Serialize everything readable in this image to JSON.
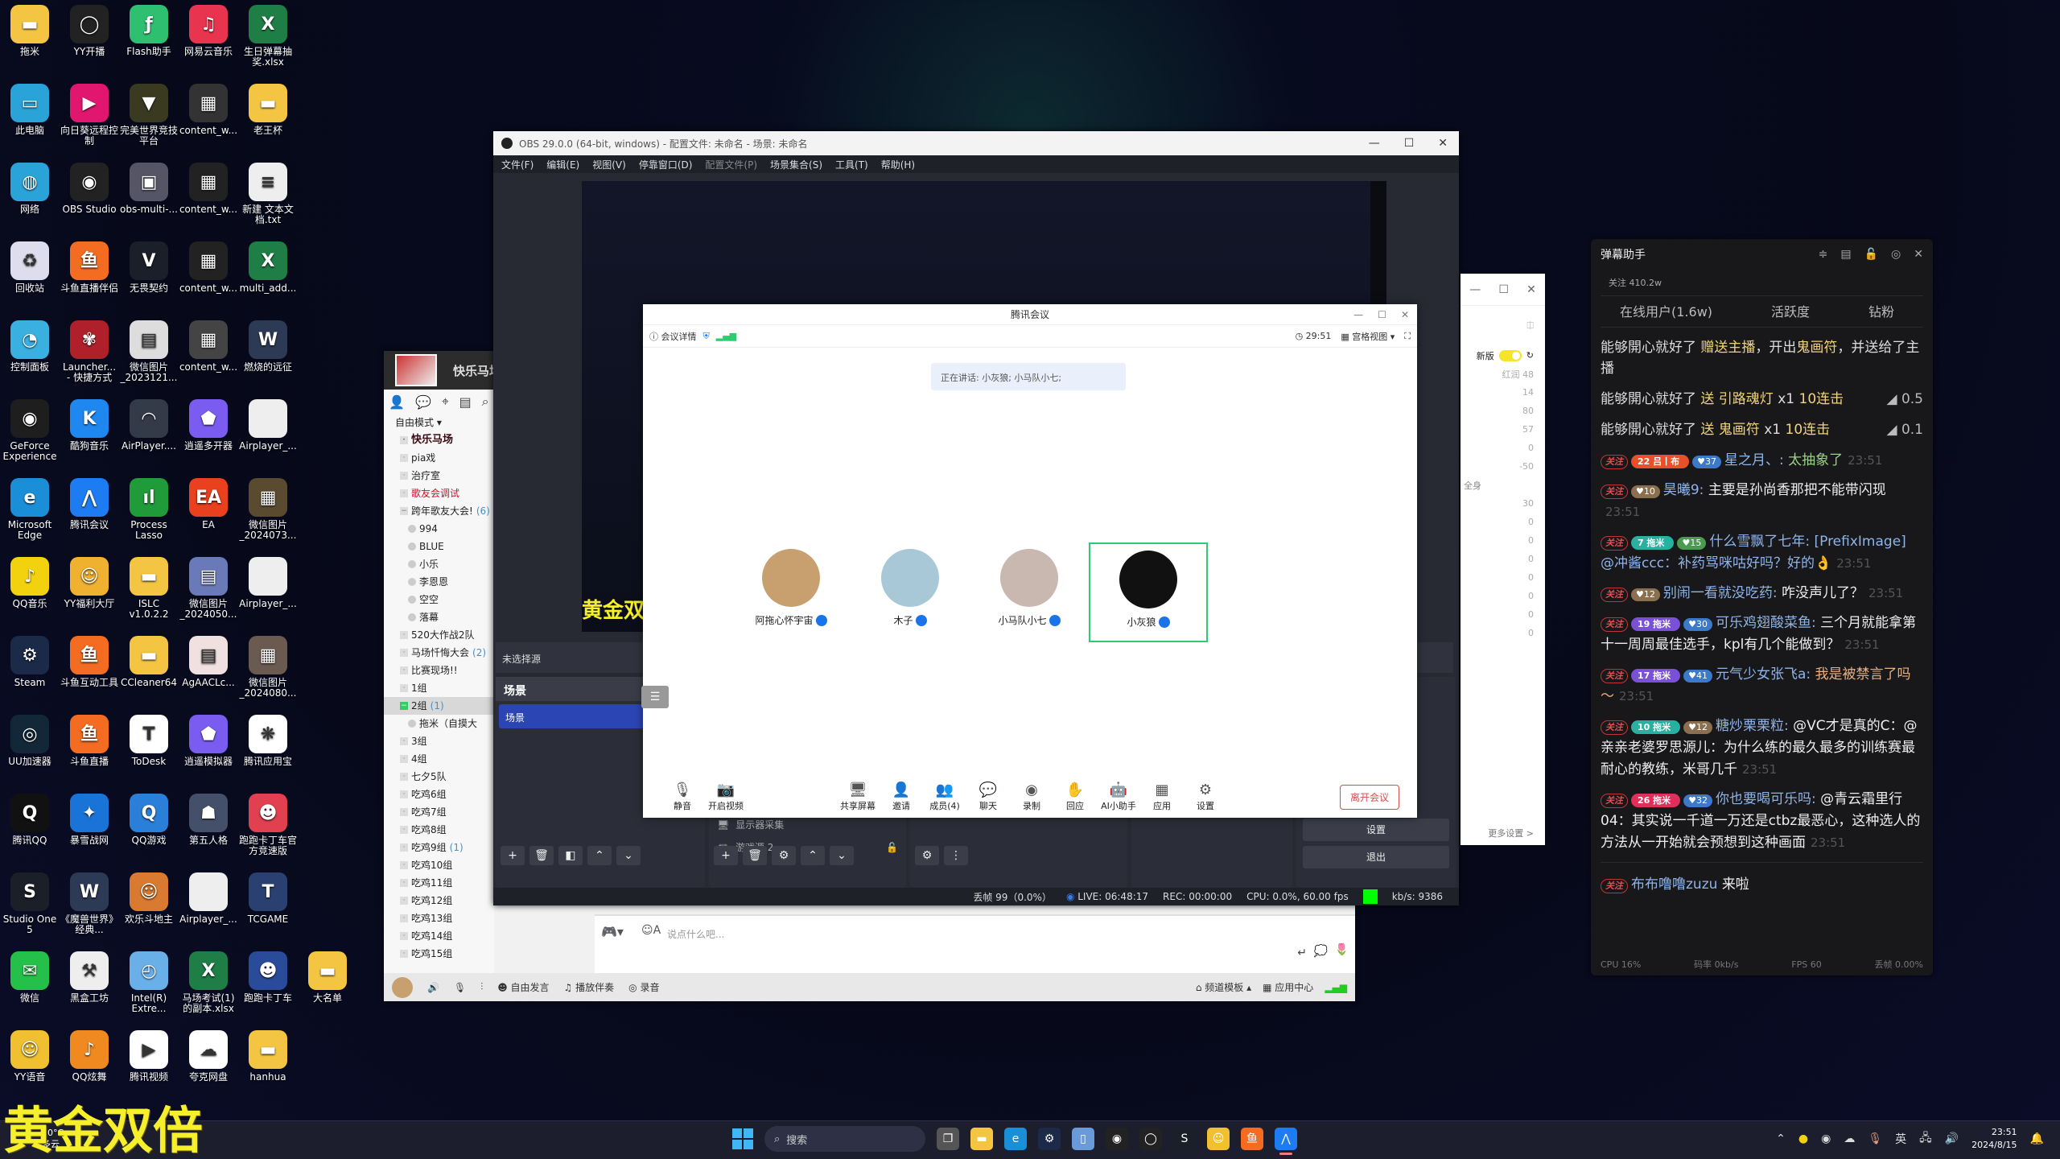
{
  "desktop": {
    "icons": [
      {
        "label": "拖米",
        "icon": "folder-icon",
        "color": "#f4c542",
        "glyph": "▬"
      },
      {
        "label": "YY开播",
        "icon": "yy-live-icon",
        "color": "#222",
        "glyph": "◯"
      },
      {
        "label": "Flash助手",
        "icon": "flash-helper-icon",
        "color": "#2fbf71",
        "glyph": "ƒ"
      },
      {
        "label": "网易云音乐",
        "icon": "netease-music-icon",
        "color": "#e8344e",
        "glyph": "♫"
      },
      {
        "label": "生日弹幕抽奖.xlsx",
        "icon": "excel-icon",
        "color": "#1e7e45",
        "glyph": "X"
      },
      {
        "label": "此电脑",
        "icon": "this-pc-icon",
        "color": "#2aa3d8",
        "glyph": "▭"
      },
      {
        "label": "向日葵远程控制",
        "icon": "sunlogin-icon",
        "color": "#e0166f",
        "glyph": "▶"
      },
      {
        "label": "完美世界竞技平台",
        "icon": "perfect-world-icon",
        "color": "#3a3a20",
        "glyph": "▼"
      },
      {
        "label": "content_w...",
        "icon": "image-file-icon",
        "color": "#333",
        "glyph": "▦"
      },
      {
        "label": "老王杯",
        "icon": "folder-icon",
        "color": "#f4c542",
        "glyph": "▬"
      },
      {
        "label": "网络",
        "icon": "network-icon",
        "color": "#2aa3d8",
        "glyph": "◍"
      },
      {
        "label": "OBS Studio",
        "icon": "obs-icon",
        "color": "#222",
        "glyph": "◉"
      },
      {
        "label": "obs-multi-...",
        "icon": "installer-icon",
        "color": "#556",
        "glyph": "▣"
      },
      {
        "label": "content_w...",
        "icon": "image-file-icon",
        "color": "#222",
        "glyph": "▦"
      },
      {
        "label": "新建 文本文档.txt",
        "icon": "text-file-icon",
        "color": "#eee",
        "glyph": "≡"
      },
      {
        "label": "回收站",
        "icon": "recycle-bin-icon",
        "color": "#dde",
        "glyph": "♻"
      },
      {
        "label": "斗鱼直播伴侣",
        "icon": "douyu-icon",
        "color": "#f36c21",
        "glyph": "鱼"
      },
      {
        "label": "无畏契约",
        "icon": "valorant-icon",
        "color": "#1b1f2a",
        "glyph": "V"
      },
      {
        "label": "content_w...",
        "icon": "image-file-icon",
        "color": "#222",
        "glyph": "▦"
      },
      {
        "label": "multi_add...",
        "icon": "excel-icon",
        "color": "#1e7e45",
        "glyph": "X"
      },
      {
        "label": "控制面板",
        "icon": "control-panel-icon",
        "color": "#3ab0e0",
        "glyph": "◔"
      },
      {
        "label": "Launcher... - 快捷方式",
        "icon": "naraka-icon",
        "color": "#b0202a",
        "glyph": "✾"
      },
      {
        "label": "微信图片_2023121...",
        "icon": "image-file-icon",
        "color": "#ddd",
        "glyph": "▤"
      },
      {
        "label": "content_w...",
        "icon": "image-file-icon",
        "color": "#444",
        "glyph": "▦"
      },
      {
        "label": "燃烧的远征",
        "icon": "wow-icon",
        "color": "#2d3a55",
        "glyph": "W"
      },
      {
        "label": "GeForce Experience",
        "icon": "nvidia-icon",
        "color": "#1e1e1e",
        "glyph": "◉"
      },
      {
        "label": "酷狗音乐",
        "icon": "kugou-icon",
        "color": "#1e88f0",
        "glyph": "K"
      },
      {
        "label": "AirPlayer....",
        "icon": "airplayer-icon",
        "color": "#333a48",
        "glyph": "◠"
      },
      {
        "label": "逍遥多开器",
        "icon": "xiaoyao-multi-icon",
        "color": "#7a5cf0",
        "glyph": "⬟"
      },
      {
        "label": "Airplayer_...",
        "icon": "blank-file-icon",
        "color": "#eee",
        "glyph": " "
      },
      {
        "label": "Microsoft Edge",
        "icon": "edge-icon",
        "color": "#1a8fd8",
        "glyph": "e"
      },
      {
        "label": "腾讯会议",
        "icon": "tencent-meeting-icon",
        "color": "#1d7cf2",
        "glyph": "⋀"
      },
      {
        "label": "Process Lasso",
        "icon": "process-lasso-icon",
        "color": "#1f9b3a",
        "glyph": "ıl"
      },
      {
        "label": "EA",
        "icon": "ea-icon",
        "color": "#e9401d",
        "glyph": "EA"
      },
      {
        "label": "微信图片_2024073...",
        "icon": "image-file-icon",
        "color": "#5a4a30",
        "glyph": "▦"
      },
      {
        "label": "QQ音乐",
        "icon": "qq-music-icon",
        "color": "#f2d20f",
        "glyph": "♪"
      },
      {
        "label": "YY福利大厅",
        "icon": "yy-welfare-icon",
        "color": "#f0b030",
        "glyph": "☺"
      },
      {
        "label": "ISLC v1.0.2.2",
        "icon": "folder-icon",
        "color": "#f4c542",
        "glyph": "▬"
      },
      {
        "label": "微信图片_2024050...",
        "icon": "image-file-icon",
        "color": "#6a7ab8",
        "glyph": "▤"
      },
      {
        "label": "Airplayer_...",
        "icon": "blank-file-icon",
        "color": "#eee",
        "glyph": " "
      },
      {
        "label": "Steam",
        "icon": "steam-icon",
        "color": "#1b2a48",
        "glyph": "⚙"
      },
      {
        "label": "斗鱼互动工具",
        "icon": "douyu-tool-icon",
        "color": "#f36c21",
        "glyph": "鱼"
      },
      {
        "label": "CCleaner64",
        "icon": "folder-icon",
        "color": "#f4c542",
        "glyph": "▬"
      },
      {
        "label": "AgAACLc...",
        "icon": "image-file-icon",
        "color": "#f0e0e0",
        "glyph": "▤"
      },
      {
        "label": "微信图片_2024080...",
        "icon": "image-file-icon",
        "color": "#6a5a50",
        "glyph": "▦"
      },
      {
        "label": "UU加速器",
        "icon": "uu-booster-icon",
        "color": "#122838",
        "glyph": "◎"
      },
      {
        "label": "斗鱼直播",
        "icon": "douyu-live-icon",
        "color": "#f36c21",
        "glyph": "鱼"
      },
      {
        "label": "ToDesk",
        "icon": "todesk-icon",
        "color": "#fff",
        "glyph": "T"
      },
      {
        "label": "逍遥模拟器",
        "icon": "xiaoyao-emulator-icon",
        "color": "#7a5cf0",
        "glyph": "⬟"
      },
      {
        "label": "腾讯应用宝",
        "icon": "tencent-appstore-icon",
        "color": "#fff",
        "glyph": "❋"
      },
      {
        "label": "腾讯QQ",
        "icon": "qq-icon",
        "color": "#111",
        "glyph": "Q"
      },
      {
        "label": "暴雪战网",
        "icon": "battlenet-icon",
        "color": "#1a74d8",
        "glyph": "✦"
      },
      {
        "label": "QQ游戏",
        "icon": "qq-game-icon",
        "color": "#2a80d8",
        "glyph": "Q"
      },
      {
        "label": "第五人格",
        "icon": "identity-v-icon",
        "color": "#44506a",
        "glyph": "☗"
      },
      {
        "label": "跑跑卡丁车官方竞速版",
        "icon": "kartrider-rush-icon",
        "color": "#e04050",
        "glyph": "☻"
      },
      {
        "label": "Studio One 5",
        "icon": "studio-one-icon",
        "color": "#1b1f28",
        "glyph": "S"
      },
      {
        "label": "《魔兽世界》经典...",
        "icon": "wow-classic-icon",
        "color": "#2d3a55",
        "glyph": "W"
      },
      {
        "label": "欢乐斗地主",
        "icon": "doudizhu-icon",
        "color": "#d97a30",
        "glyph": "☺"
      },
      {
        "label": "Airplayer_...",
        "icon": "blank-file-icon",
        "color": "#eee",
        "glyph": " "
      },
      {
        "label": "TCGAME",
        "icon": "tcgame-icon",
        "color": "#2a4070",
        "glyph": "T"
      },
      {
        "label": "微信",
        "icon": "wechat-icon",
        "color": "#25c04a",
        "glyph": "✉"
      },
      {
        "label": "黑盒工坊",
        "icon": "heihe-icon",
        "color": "#eee",
        "glyph": "⚒"
      },
      {
        "label": "Intel(R) Extre...",
        "icon": "intel-xtu-icon",
        "color": "#6ab0e8",
        "glyph": "◴"
      },
      {
        "label": "马场考试(1)的副本.xlsx",
        "icon": "excel-icon",
        "color": "#1e7e45",
        "glyph": "X"
      },
      {
        "label": "跑跑卡丁车",
        "icon": "kartrider-icon",
        "color": "#2a4a9a",
        "glyph": "☻"
      },
      {
        "label": "大名单",
        "icon": "folder-icon",
        "color": "#f4c542",
        "glyph": "▬"
      },
      {
        "label": "YY语音",
        "icon": "yy-voice-icon",
        "color": "#f0c030",
        "glyph": "☺"
      },
      {
        "label": "QQ炫舞",
        "icon": "qq-dance-icon",
        "color": "#f08a20",
        "glyph": "♪"
      },
      {
        "label": "腾讯视频",
        "icon": "tencent-video-icon",
        "color": "#fff",
        "glyph": "▶"
      },
      {
        "label": "夸克网盘",
        "icon": "quark-drive-icon",
        "color": "#fff",
        "glyph": "☁"
      },
      {
        "label": "hanhua",
        "icon": "folder-icon",
        "color": "#f4c542",
        "glyph": "▬"
      }
    ],
    "overlay_text": "黄金双倍"
  },
  "yy": {
    "channel_name": "快乐马场",
    "mode": "自由模式",
    "tree": [
      {
        "label": "快乐马场",
        "type": "root"
      },
      {
        "label": "pia戏",
        "type": "item"
      },
      {
        "label": "治疗室",
        "type": "item"
      },
      {
        "label": "歌友会调试",
        "type": "red"
      },
      {
        "label": "跨年歌友大会!",
        "count": "(6)",
        "type": "expanded"
      },
      {
        "label": "994",
        "type": "member"
      },
      {
        "label": "BLUE",
        "type": "member"
      },
      {
        "label": "小乐",
        "type": "member"
      },
      {
        "label": "李恩恩",
        "type": "member"
      },
      {
        "label": "空空",
        "type": "member"
      },
      {
        "label": "落幕",
        "type": "member"
      },
      {
        "label": "520大作战2队",
        "type": "item"
      },
      {
        "label": "马场忏悔大会",
        "count": "(2)",
        "type": "item"
      },
      {
        "label": "比赛现场!!",
        "type": "item"
      },
      {
        "label": "1组",
        "type": "item"
      },
      {
        "label": "2组",
        "count": "(1)",
        "type": "selected"
      },
      {
        "label": "拖米（自摸大",
        "type": "member"
      },
      {
        "label": "3组",
        "type": "item"
      },
      {
        "label": "4组",
        "type": "item"
      },
      {
        "label": "七夕5队",
        "type": "item"
      },
      {
        "label": "吃鸡6组",
        "type": "item"
      },
      {
        "label": "吃鸡7组",
        "type": "item"
      },
      {
        "label": "吃鸡8组",
        "type": "item"
      },
      {
        "label": "吃鸡9组",
        "count": "(1)",
        "type": "item"
      },
      {
        "label": "吃鸡10组",
        "type": "item"
      },
      {
        "label": "吃鸡11组",
        "type": "item"
      },
      {
        "label": "吃鸡12组",
        "type": "item"
      },
      {
        "label": "吃鸡13组",
        "type": "item"
      },
      {
        "label": "吃鸡14组",
        "type": "item"
      },
      {
        "label": "吃鸡15组",
        "type": "item"
      }
    ],
    "input_placeholder": "说点什么吧...",
    "bottom": {
      "free_talk": "自由发言",
      "play_accompaniment": "播放伴奏",
      "record": "录音",
      "channel_template": "频道模板",
      "app_center": "应用中心"
    }
  },
  "obs": {
    "title": "OBS 29.0.0 (64-bit, windows) - 配置文件: 未命名 - 场景: 未命名",
    "menu": [
      "文件(F)",
      "编辑(E)",
      "视图(V)",
      "停靠窗口(D)",
      "配置文件(P)",
      "场景集合(S)",
      "工具(T)",
      "帮助(H)"
    ],
    "no_source": "未选择源",
    "scenes_title": "场景",
    "scene_selected": "场景",
    "sources": [
      "显示器采集",
      "游戏源 2"
    ],
    "controls": [
      "设置",
      "退出"
    ],
    "status": {
      "dropped": "丢帧 99（0.0%）",
      "live": "LIVE: 06:48:17",
      "rec": "REC: 00:00:00",
      "cpu": "CPU: 0.0%, 60.00 fps",
      "bitrate": "kb/s: 9386"
    },
    "preview_overlay": "黄金双倍"
  },
  "beauty_panel": {
    "new_version": "新版",
    "values": [
      "红润 48",
      "14",
      "80",
      "57",
      "0",
      "-50"
    ],
    "full_body": "全身",
    "values2": [
      "30",
      "0",
      "0",
      "0",
      "0",
      "0",
      "0",
      "0"
    ],
    "more_settings": "更多设置 >"
  },
  "meeting": {
    "title": "腾讯会议",
    "details": "会议详情",
    "timer": "29:51",
    "view_mode": "宫格视图",
    "speaking": "正在讲话: 小灰狼; 小马队小七;",
    "participants": [
      {
        "name": "阿拖心怀宇宙",
        "avatar_color": "#c8a070",
        "active": false
      },
      {
        "name": "木子",
        "avatar_color": "#a8c8d8",
        "active": false
      },
      {
        "name": "小马队小七",
        "avatar_color": "#c8b8b0",
        "active": false
      },
      {
        "name": "小灰狼",
        "avatar_color": "#111111",
        "active": true
      }
    ],
    "toolbar": [
      "静音",
      "开启视频",
      "共享屏幕",
      "邀请",
      "成员(4)",
      "聊天",
      "录制",
      "回应",
      "AI小助手",
      "应用",
      "设置"
    ],
    "leave": "离开会议"
  },
  "danmaku": {
    "title": "弹幕助手",
    "followers": "关注 410.2w",
    "tabs": [
      "在线用户(1.6w)",
      "活跃度",
      "钻粉"
    ],
    "gifts": [
      {
        "user": "能够開心就好了",
        "action": "赠送主播",
        "text": "，开出",
        "item": "鬼画符",
        "tail": "，并送给了主播",
        "value": ""
      },
      {
        "user": "能够開心就好了",
        "action": "送 引路魂灯",
        "text": " x1 ",
        "item": "10连击",
        "tail": "",
        "value": "0.5"
      },
      {
        "user": "能够開心就好了",
        "action": "送 鬼画符",
        "text": " x1 ",
        "item": "10连击",
        "tail": "",
        "value": "0.1"
      }
    ],
    "messages": [
      {
        "follow": "关注",
        "fan_lvl": "22",
        "fan_name": "吕丨布",
        "fan_color": "#e8502a",
        "lvl": "37",
        "lvl_color": "#3a7ac8",
        "user": "星之月、",
        "text": "太抽象了",
        "text_color": "#9bd08a",
        "time": "23:51"
      },
      {
        "follow": "关注",
        "fan_lvl": "",
        "fan_name": "",
        "fan_color": "",
        "lvl": "10",
        "lvl_color": "#8a7050",
        "user": "昊曦9",
        "text": "主要是孙尚香那把不能带闪现",
        "text_color": "#eeeeee",
        "time": "23:51"
      },
      {
        "follow": "关注",
        "fan_lvl": "7",
        "fan_name": "拖米",
        "fan_color": "#2ab0a0",
        "lvl": "15",
        "lvl_color": "#4a9a50",
        "user": "什么雪飘了七年",
        "text": "[PrefixImage] @冲酱ccc：补药骂咪咕好吗？好的👌",
        "text_color": "#8fb4e8",
        "time": "23:51"
      },
      {
        "follow": "关注",
        "fan_lvl": "",
        "fan_name": "",
        "fan_color": "",
        "lvl": "12",
        "lvl_color": "#8a7050",
        "user": "别闹一看就没吃药",
        "text": "咋没声儿了？",
        "text_color": "#eeeeee",
        "time": "23:51"
      },
      {
        "follow": "关注",
        "fan_lvl": "19",
        "fan_name": "拖米",
        "fan_color": "#7a50d8",
        "lvl": "30",
        "lvl_color": "#3a7ac8",
        "user": "可乐鸡翅酸菜鱼",
        "text": "三个月就能拿第十一周周最佳选手，kpl有几个能做到？",
        "text_color": "#eeeeee",
        "time": "23:51"
      },
      {
        "follow": "关注",
        "fan_lvl": "17",
        "fan_name": "拖米",
        "fan_color": "#7a50d8",
        "lvl": "41",
        "lvl_color": "#3a7ac8",
        "user": "元气少女张飞a",
        "text": "我是被禁言了吗～",
        "text_color": "#e8b080",
        "time": "23:51"
      },
      {
        "follow": "关注",
        "fan_lvl": "10",
        "fan_name": "拖米",
        "fan_color": "#2ab0a0",
        "lvl": "12",
        "lvl_color": "#8a7050",
        "user": "糖炒栗栗粒",
        "text": "@VC才是真的C：@亲亲老婆罗思源儿：为什么练的最久最多的训练赛最耐心的教练，米哥几千",
        "text_color": "#eeeeee",
        "time": "23:51"
      },
      {
        "follow": "关注",
        "fan_lvl": "26",
        "fan_name": "拖米",
        "fan_color": "#e0305a",
        "lvl": "32",
        "lvl_color": "#3a7ac8",
        "user": "你也要喝可乐吗",
        "text": "@青云霜里行04：其实说一千道一万还是ctbz最恶心，这种选人的方法从一开始就会预想到这种画面",
        "text_color": "#eeeeee",
        "time": "23:51"
      }
    ],
    "enter": {
      "follow": "关注",
      "user": "布布噜噜zuzu",
      "text": "来啦"
    },
    "footer": [
      "CPU 16%",
      "码率 0kb/s",
      "FPS 60",
      "丢帧 0.00%"
    ]
  },
  "taskbar": {
    "weather_temp": "30°C",
    "weather_desc": "多云",
    "search_placeholder": "搜索",
    "apps": [
      {
        "name": "task-view",
        "glyph": "❐",
        "color": "#555"
      },
      {
        "name": "file-explorer",
        "glyph": "▬",
        "color": "#f4c542"
      },
      {
        "name": "edge",
        "glyph": "e",
        "color": "#1a8fd8"
      },
      {
        "name": "steam",
        "glyph": "⚙",
        "color": "#1b2a48"
      },
      {
        "name": "document",
        "glyph": "▯",
        "color": "#6a9ad8"
      },
      {
        "name": "obs",
        "glyph": "◉",
        "color": "#222"
      },
      {
        "name": "yy-live",
        "glyph": "◯",
        "color": "#222"
      },
      {
        "name": "studio-one",
        "glyph": "S",
        "color": "#1b1f28"
      },
      {
        "name": "yy-voice",
        "glyph": "☺",
        "color": "#f0c030"
      },
      {
        "name": "douyu",
        "glyph": "鱼",
        "color": "#f36c21"
      },
      {
        "name": "tencent-meeting",
        "glyph": "⋀",
        "color": "#1d7cf2"
      }
    ],
    "ime": "英",
    "time": "23:51",
    "date": "2024/8/15"
  }
}
